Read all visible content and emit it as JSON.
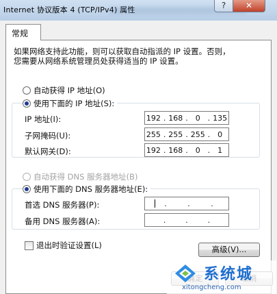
{
  "window": {
    "title": "Internet 协议版本 4 (TCP/IPv4) 属性",
    "help_label": "?",
    "close_label": "✕"
  },
  "tabs": [
    {
      "label": "常规",
      "active": true
    }
  ],
  "description": {
    "line1": "如果网络支持此功能，则可以获取自动指派的 IP 设置。否则，",
    "line2": "您需要从网络系统管理员处获得适当的 IP 设置。"
  },
  "ip_mode": {
    "auto_label": "自动获得 IP 地址(O)",
    "manual_label": "使用下面的 IP 地址(S):",
    "selected": "manual"
  },
  "ip_fields": [
    {
      "label": "IP 地址(I):",
      "octets": [
        "192",
        "168",
        "0",
        "135"
      ]
    },
    {
      "label": "子网掩码(U):",
      "octets": [
        "255",
        "255",
        "255",
        "0"
      ]
    },
    {
      "label": "默认网关(D):",
      "octets": [
        "192",
        "168",
        "0",
        "1"
      ]
    }
  ],
  "dns_mode": {
    "auto_label": "自动获得 DNS 服务器地址(B)",
    "manual_label": "使用下面的 DNS 服务器地址(E):",
    "selected": "manual"
  },
  "dns_fields": [
    {
      "label": "首选 DNS 服务器(P):",
      "octets": [
        "",
        "",
        "",
        ""
      ]
    },
    {
      "label": "备用 DNS 服务器(A):",
      "octets": [
        "",
        "",
        "",
        ""
      ]
    }
  ],
  "validate_checkbox": {
    "label": "退出时验证设置(L)",
    "checked": false
  },
  "buttons": {
    "advanced": "高级(V)...",
    "ok": "确定",
    "cancel": "取消"
  },
  "watermark": {
    "name": "系统城",
    "url": "xitongcheng.com"
  },
  "colors": {
    "accent": "#1f6fd0",
    "close": "#c0422c"
  }
}
